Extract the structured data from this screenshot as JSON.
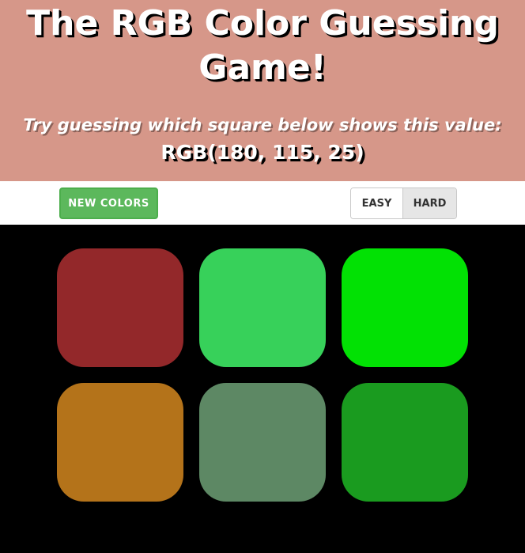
{
  "header": {
    "title": "The RGB Color Guessing Game!",
    "prompt": "Try guessing which square below shows this value:",
    "target_rgb": "RGB(180, 115, 25)",
    "background_color": "#d69789"
  },
  "toolbar": {
    "new_colors_label": "New Colors",
    "modes": [
      {
        "label": "Easy",
        "selected": false
      },
      {
        "label": "Hard",
        "selected": true
      }
    ]
  },
  "board": {
    "background_color": "#000000",
    "squares": [
      {
        "color": "#93282a"
      },
      {
        "color": "#37d15a"
      },
      {
        "color": "#02e104"
      },
      {
        "color": "#b4731a"
      },
      {
        "color": "#5d8864"
      },
      {
        "color": "#1a9b1f"
      }
    ]
  }
}
